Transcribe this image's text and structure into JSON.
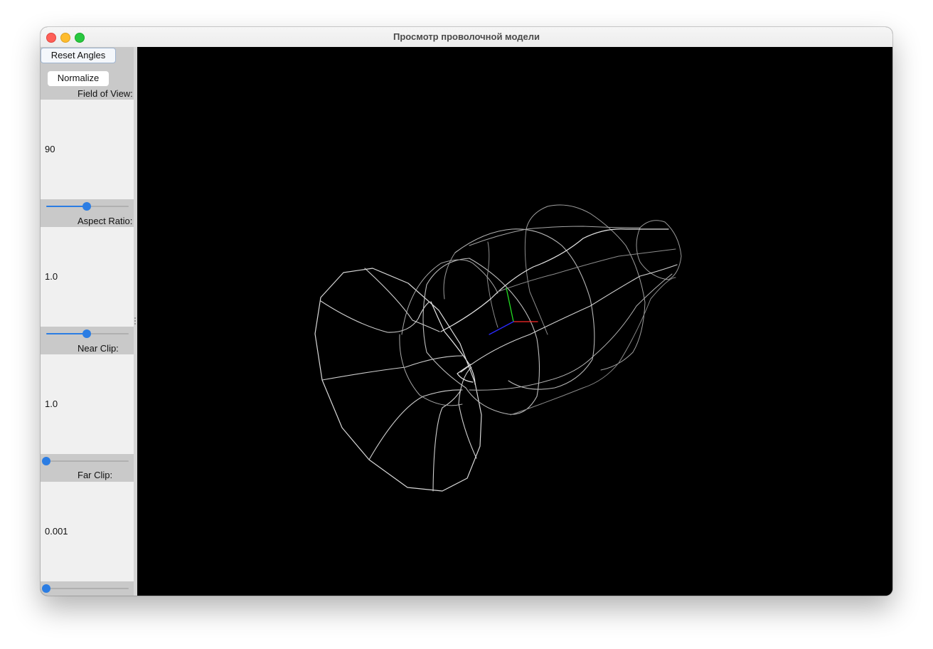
{
  "window": {
    "title": "Просмотр проволочной модели"
  },
  "sidebar": {
    "reset_label": "Reset Angles",
    "normalize_label": "Normalize",
    "fov": {
      "label": "Field of View:",
      "value": "90",
      "slider_fraction": 0.48
    },
    "aspect": {
      "label": "Aspect Ratio:",
      "value": "1.0",
      "slider_fraction": 0.48
    },
    "near": {
      "label": "Near Clip:",
      "value": "1.0",
      "slider_fraction": 0.0
    },
    "far": {
      "label": "Far Clip:",
      "value": "0.001",
      "slider_fraction": 0.0
    }
  },
  "colors": {
    "slider_accent": "#2b7de3",
    "axis_x": "#ff2a2a",
    "axis_y": "#22dd22",
    "axis_z": "#2a2aff",
    "wire": "#d8d8d8"
  }
}
